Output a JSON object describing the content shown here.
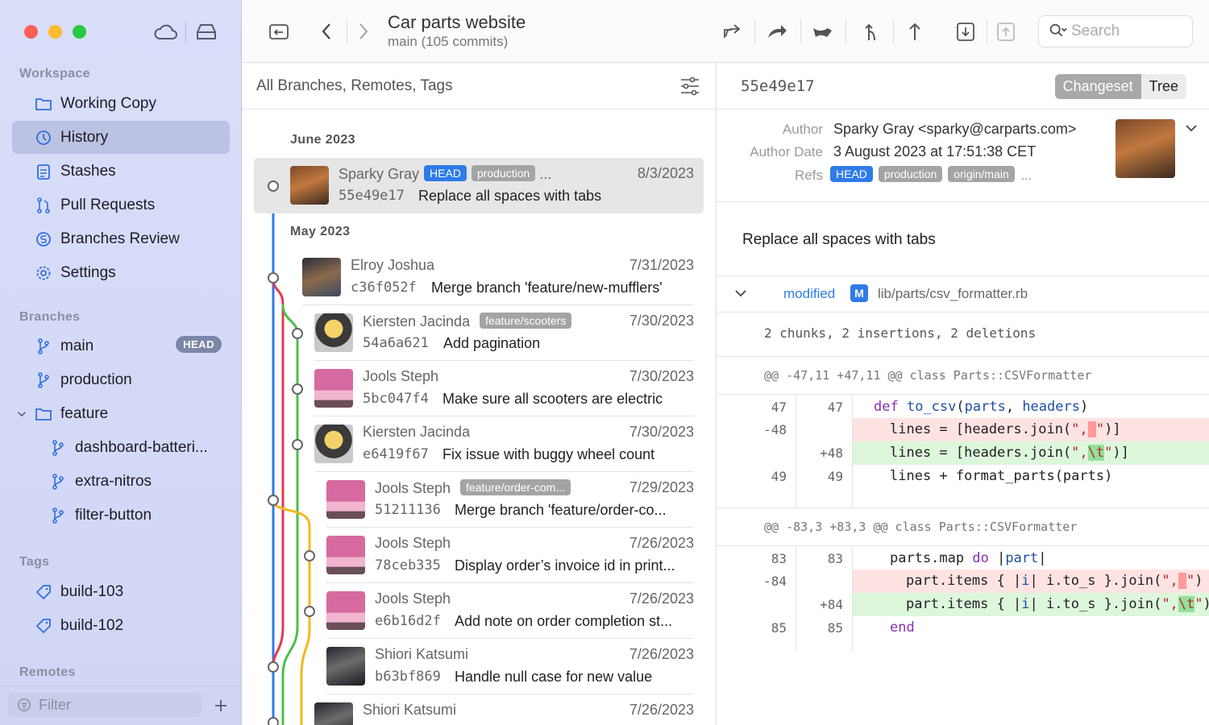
{
  "sidebar": {
    "workspace_header": "Workspace",
    "workspace_items": [
      {
        "label": "Working Copy",
        "icon": "folder-icon"
      },
      {
        "label": "History",
        "icon": "clock-icon"
      },
      {
        "label": "Stashes",
        "icon": "clipboard-icon"
      },
      {
        "label": "Pull Requests",
        "icon": "pull-request-icon"
      },
      {
        "label": "Branches Review",
        "icon": "branches-review-icon"
      },
      {
        "label": "Settings",
        "icon": "gear-icon"
      }
    ],
    "selected": "History",
    "branches_header": "Branches",
    "branches": [
      {
        "label": "main",
        "badge": "HEAD"
      },
      {
        "label": "production"
      },
      {
        "label": "feature"
      },
      {
        "label": "dashboard-batteri..."
      },
      {
        "label": "extra-nitros"
      },
      {
        "label": "filter-button"
      }
    ],
    "tags_header": "Tags",
    "tags": [
      {
        "label": "build-103"
      },
      {
        "label": "build-102"
      }
    ],
    "remotes_header": "Remotes",
    "filter_placeholder": "Filter"
  },
  "toolbar": {
    "title": "Car parts website",
    "subtitle": "main (105 commits)",
    "search_placeholder": "Search"
  },
  "list": {
    "header": "All Branches, Remotes, Tags",
    "months": [
      "June 2023",
      "May 2023"
    ],
    "commits": [
      {
        "author": "Sparky Gray",
        "tags": [
          "HEAD",
          "production",
          "..."
        ],
        "date": "8/3/2023",
        "hash": "55e49e17",
        "message": "Replace all spaces with tabs",
        "avatar": "car"
      },
      {
        "author": "Elroy Joshua",
        "tags": [],
        "date": "7/31/2023",
        "hash": "c36f052f",
        "message": "Merge branch 'feature/new-mufflers'",
        "avatar": "person"
      },
      {
        "author": "Kiersten Jacinda",
        "tags": [
          "feature/scooters"
        ],
        "date": "7/30/2023",
        "hash": "54a6a621",
        "message": "Add pagination",
        "avatar": "helmet"
      },
      {
        "author": "Jools Steph",
        "tags": [],
        "date": "7/30/2023",
        "hash": "5bc047f4",
        "message": "Make sure all scooters are electric",
        "avatar": "pink"
      },
      {
        "author": "Kiersten Jacinda",
        "tags": [],
        "date": "7/30/2023",
        "hash": "e6419f67",
        "message": "Fix issue with buggy wheel count",
        "avatar": "helmet"
      },
      {
        "author": "Jools Steph",
        "tags": [
          "feature/order-com..."
        ],
        "date": "7/29/2023",
        "hash": "51211136",
        "message": "Merge branch 'feature/order-co...",
        "avatar": "pink"
      },
      {
        "author": "Jools Steph",
        "tags": [],
        "date": "7/26/2023",
        "hash": "78ceb335",
        "message": "Display order’s invoice id in print...",
        "avatar": "pink"
      },
      {
        "author": "Jools Steph",
        "tags": [],
        "date": "7/26/2023",
        "hash": "e6b16d2f",
        "message": "Add note on order completion st...",
        "avatar": "pink"
      },
      {
        "author": "Shiori Katsumi",
        "tags": [],
        "date": "7/26/2023",
        "hash": "b63bf869",
        "message": "Handle null case for new value",
        "avatar": "dark"
      },
      {
        "author": "Shiori Katsumi",
        "tags": [],
        "date": "7/26/2023",
        "hash": "",
        "message": "",
        "avatar": "dark"
      }
    ]
  },
  "detail": {
    "hash": "55e49e17",
    "tabs": [
      "Changeset",
      "Tree"
    ],
    "active_tab": "Changeset",
    "author_label": "Author",
    "author": "Sparky Gray <sparky@carparts.com>",
    "date_label": "Author Date",
    "date": "3 August 2023 at 17:51:38 CET",
    "refs_label": "Refs",
    "refs": [
      "HEAD",
      "production",
      "origin/main"
    ],
    "refs_more": "...",
    "message": "Replace all spaces with tabs",
    "file_status": "modified",
    "file_badge": "M",
    "file_path": "lib/parts/csv_formatter.rb",
    "stats": "2 chunks, 2 insertions, 2 deletions",
    "hunk1": "@@ -47,11 +47,11 @@ class Parts::CSVFormatter",
    "hunk2": "@@ -83,3 +83,3 @@ class Parts::CSVFormatter",
    "lines1": [
      {
        "old": "47",
        "new": "47",
        "type": "ctx"
      },
      {
        "old": "-48",
        "new": "",
        "type": "del"
      },
      {
        "old": "",
        "new": "+48",
        "type": "add"
      },
      {
        "old": "49",
        "new": "49",
        "type": "ctx"
      }
    ],
    "lines2": [
      {
        "old": "83",
        "new": "83",
        "type": "ctx",
        "text": "    parts.map do |part|"
      },
      {
        "old": "-84",
        "new": "",
        "type": "del"
      },
      {
        "old": "",
        "new": "+84",
        "type": "add"
      },
      {
        "old": "85",
        "new": "85",
        "type": "ctx",
        "text": "    end"
      }
    ]
  },
  "colors": {
    "accent": "#2f7be8",
    "graph_blue": "#2f7be8",
    "graph_red": "#e23a4b",
    "graph_green": "#4bbf4f",
    "graph_yellow": "#f3b81c"
  }
}
